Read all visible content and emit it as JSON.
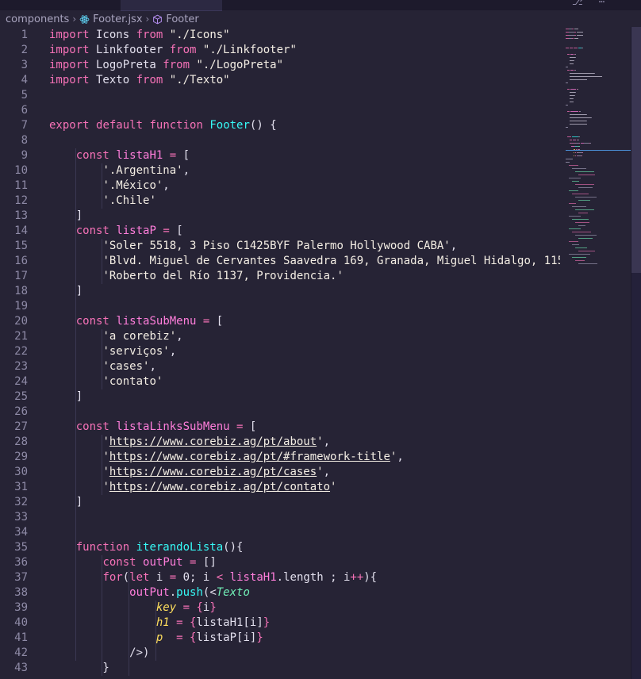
{
  "breadcrumb": {
    "folder": "components",
    "file": "Footer.jsx",
    "symbol": "Footer"
  },
  "colors": {
    "background": "#262335",
    "keyword": "#fede5d",
    "keyword_alt": "#f772b8",
    "function": "#36f9f6",
    "string": "#ff8b39",
    "variable": "#ff7edb",
    "jsx_tag": "#72f1b8"
  },
  "lines": [
    {
      "n": "1",
      "tokens": [
        [
          "kw2",
          "import"
        ],
        [
          "plain",
          " Icons "
        ],
        [
          "kw2",
          "from"
        ],
        [
          "plain",
          " "
        ],
        [
          "strg",
          "\"./Icons\""
        ]
      ]
    },
    {
      "n": "2",
      "tokens": [
        [
          "kw2",
          "import"
        ],
        [
          "plain",
          " Linkfooter "
        ],
        [
          "kw2",
          "from"
        ],
        [
          "plain",
          " "
        ],
        [
          "strg",
          "\"./Linkfooter\""
        ]
      ]
    },
    {
      "n": "3",
      "tokens": [
        [
          "kw2",
          "import"
        ],
        [
          "plain",
          " LogoPreta "
        ],
        [
          "kw2",
          "from"
        ],
        [
          "plain",
          " "
        ],
        [
          "strg",
          "\"./LogoPreta\""
        ]
      ]
    },
    {
      "n": "4",
      "tokens": [
        [
          "kw2",
          "import"
        ],
        [
          "plain",
          " Texto "
        ],
        [
          "kw2",
          "from"
        ],
        [
          "plain",
          " "
        ],
        [
          "strg",
          "\"./Texto\""
        ]
      ]
    },
    {
      "n": "5",
      "tokens": []
    },
    {
      "n": "6",
      "tokens": []
    },
    {
      "n": "7",
      "tokens": [
        [
          "kw2",
          "export"
        ],
        [
          "plain",
          " "
        ],
        [
          "kw2",
          "default"
        ],
        [
          "plain",
          " "
        ],
        [
          "kw2",
          "function"
        ],
        [
          "plain",
          " "
        ],
        [
          "fn",
          "Footer"
        ],
        [
          "plain",
          "() {"
        ]
      ]
    },
    {
      "n": "8",
      "tokens": []
    },
    {
      "n": "9",
      "tokens": [
        [
          "plain",
          "    "
        ],
        [
          "kw2",
          "const"
        ],
        [
          "plain",
          " "
        ],
        [
          "var",
          "listaH1"
        ],
        [
          "plain",
          " "
        ],
        [
          "kw2",
          "="
        ],
        [
          "plain",
          " ["
        ]
      ]
    },
    {
      "n": "10",
      "tokens": [
        [
          "plain",
          "        "
        ],
        [
          "strg",
          "'.Argentina'"
        ],
        [
          "plain",
          ","
        ]
      ]
    },
    {
      "n": "11",
      "tokens": [
        [
          "plain",
          "        "
        ],
        [
          "strg",
          "'.México'"
        ],
        [
          "plain",
          ","
        ]
      ]
    },
    {
      "n": "12",
      "tokens": [
        [
          "plain",
          "        "
        ],
        [
          "strg",
          "'.Chile'"
        ]
      ]
    },
    {
      "n": "13",
      "tokens": [
        [
          "plain",
          "    ]"
        ]
      ]
    },
    {
      "n": "14",
      "tokens": [
        [
          "plain",
          "    "
        ],
        [
          "kw2",
          "const"
        ],
        [
          "plain",
          " "
        ],
        [
          "var",
          "listaP"
        ],
        [
          "plain",
          " "
        ],
        [
          "kw2",
          "="
        ],
        [
          "plain",
          " ["
        ]
      ]
    },
    {
      "n": "15",
      "tokens": [
        [
          "plain",
          "        "
        ],
        [
          "strg",
          "'Soler 5518, 3 Piso C1425BYF Palermo Hollywood CABA'"
        ],
        [
          "plain",
          ","
        ]
      ]
    },
    {
      "n": "16",
      "tokens": [
        [
          "plain",
          "        "
        ],
        [
          "strg",
          "'Blvd. Miguel de Cervantes Saavedra 169, Granada, Miguel Hidalgo, 115"
        ]
      ]
    },
    {
      "n": "17",
      "tokens": [
        [
          "plain",
          "        "
        ],
        [
          "strg",
          "'Roberto del Río 1137, Providencia.'"
        ]
      ]
    },
    {
      "n": "18",
      "tokens": [
        [
          "plain",
          "    ]"
        ]
      ]
    },
    {
      "n": "19",
      "tokens": []
    },
    {
      "n": "20",
      "tokens": [
        [
          "plain",
          "    "
        ],
        [
          "kw2",
          "const"
        ],
        [
          "plain",
          " "
        ],
        [
          "var",
          "listaSubMenu"
        ],
        [
          "plain",
          " "
        ],
        [
          "kw2",
          "="
        ],
        [
          "plain",
          " ["
        ]
      ]
    },
    {
      "n": "21",
      "tokens": [
        [
          "plain",
          "        "
        ],
        [
          "strg",
          "'a corebiz'"
        ],
        [
          "plain",
          ","
        ]
      ]
    },
    {
      "n": "22",
      "tokens": [
        [
          "plain",
          "        "
        ],
        [
          "strg",
          "'serviços'"
        ],
        [
          "plain",
          ","
        ]
      ]
    },
    {
      "n": "23",
      "tokens": [
        [
          "plain",
          "        "
        ],
        [
          "strg",
          "'cases'"
        ],
        [
          "plain",
          ","
        ]
      ]
    },
    {
      "n": "24",
      "tokens": [
        [
          "plain",
          "        "
        ],
        [
          "strg",
          "'contato'"
        ]
      ]
    },
    {
      "n": "25",
      "tokens": [
        [
          "plain",
          "    ]"
        ]
      ]
    },
    {
      "n": "26",
      "tokens": []
    },
    {
      "n": "27",
      "tokens": [
        [
          "plain",
          "    "
        ],
        [
          "kw2",
          "const"
        ],
        [
          "plain",
          " "
        ],
        [
          "var",
          "listaLinksSubMenu"
        ],
        [
          "plain",
          " "
        ],
        [
          "kw2",
          "="
        ],
        [
          "plain",
          " ["
        ]
      ]
    },
    {
      "n": "28",
      "tokens": [
        [
          "plain",
          "        "
        ],
        [
          "strg",
          "'"
        ],
        [
          "url",
          "https://www.corebiz.ag/pt/about"
        ],
        [
          "strg",
          "'"
        ],
        [
          "plain",
          ","
        ]
      ]
    },
    {
      "n": "29",
      "tokens": [
        [
          "plain",
          "        "
        ],
        [
          "strg",
          "'"
        ],
        [
          "url",
          "https://www.corebiz.ag/pt/#framework-title"
        ],
        [
          "strg",
          "'"
        ],
        [
          "plain",
          ","
        ]
      ]
    },
    {
      "n": "30",
      "tokens": [
        [
          "plain",
          "        "
        ],
        [
          "strg",
          "'"
        ],
        [
          "url",
          "https://www.corebiz.ag/pt/cases"
        ],
        [
          "strg",
          "'"
        ],
        [
          "plain",
          ","
        ]
      ]
    },
    {
      "n": "31",
      "tokens": [
        [
          "plain",
          "        "
        ],
        [
          "strg",
          "'"
        ],
        [
          "url",
          "https://www.corebiz.ag/pt/contato"
        ],
        [
          "strg",
          "'"
        ]
      ]
    },
    {
      "n": "32",
      "tokens": [
        [
          "plain",
          "    ]"
        ]
      ]
    },
    {
      "n": "33",
      "tokens": []
    },
    {
      "n": "34",
      "tokens": []
    },
    {
      "n": "35",
      "tokens": [
        [
          "plain",
          "    "
        ],
        [
          "kw2",
          "function"
        ],
        [
          "plain",
          " "
        ],
        [
          "fn",
          "iterandoLista"
        ],
        [
          "plain",
          "(){"
        ]
      ]
    },
    {
      "n": "36",
      "tokens": [
        [
          "plain",
          "        "
        ],
        [
          "kw2",
          "const"
        ],
        [
          "plain",
          " "
        ],
        [
          "var",
          "outPut"
        ],
        [
          "plain",
          " "
        ],
        [
          "kw2",
          "="
        ],
        [
          "plain",
          " []"
        ]
      ]
    },
    {
      "n": "37",
      "tokens": [
        [
          "plain",
          "        "
        ],
        [
          "kw2",
          "for"
        ],
        [
          "plain",
          "("
        ],
        [
          "kw2",
          "let"
        ],
        [
          "plain",
          " i "
        ],
        [
          "kw2",
          "="
        ],
        [
          "plain",
          " 0; i "
        ],
        [
          "kw2",
          "<"
        ],
        [
          "plain",
          " "
        ],
        [
          "var",
          "listaH1"
        ],
        [
          "plain",
          ".length ; i"
        ],
        [
          "kw2",
          "++"
        ],
        [
          "plain",
          "){"
        ]
      ]
    },
    {
      "n": "38",
      "tokens": [
        [
          "plain",
          "            "
        ],
        [
          "var",
          "outPut"
        ],
        [
          "plain",
          "."
        ],
        [
          "fn",
          "push"
        ],
        [
          "plain",
          "(<"
        ],
        [
          "tag",
          "Texto"
        ]
      ]
    },
    {
      "n": "39",
      "tokens": [
        [
          "plain",
          "                "
        ],
        [
          "attr",
          "key"
        ],
        [
          "plain",
          " "
        ],
        [
          "kw2",
          "="
        ],
        [
          "plain",
          " "
        ],
        [
          "kw2",
          "{"
        ],
        [
          "plain",
          "i"
        ],
        [
          "kw2",
          "}"
        ]
      ]
    },
    {
      "n": "40",
      "tokens": [
        [
          "plain",
          "                "
        ],
        [
          "attr",
          "h1"
        ],
        [
          "plain",
          " "
        ],
        [
          "kw2",
          "="
        ],
        [
          "plain",
          " "
        ],
        [
          "kw2",
          "{"
        ],
        [
          "plain",
          "listaH1[i]"
        ],
        [
          "kw2",
          "}"
        ]
      ]
    },
    {
      "n": "41",
      "tokens": [
        [
          "plain",
          "                "
        ],
        [
          "attr",
          "p"
        ],
        [
          "plain",
          "  "
        ],
        [
          "kw2",
          "="
        ],
        [
          "plain",
          " "
        ],
        [
          "kw2",
          "{"
        ],
        [
          "plain",
          "listaP[i]"
        ],
        [
          "kw2",
          "}"
        ]
      ]
    },
    {
      "n": "42",
      "tokens": [
        [
          "plain",
          "            />)"
        ]
      ]
    },
    {
      "n": "43",
      "tokens": [
        [
          "plain",
          "        }"
        ]
      ]
    }
  ]
}
